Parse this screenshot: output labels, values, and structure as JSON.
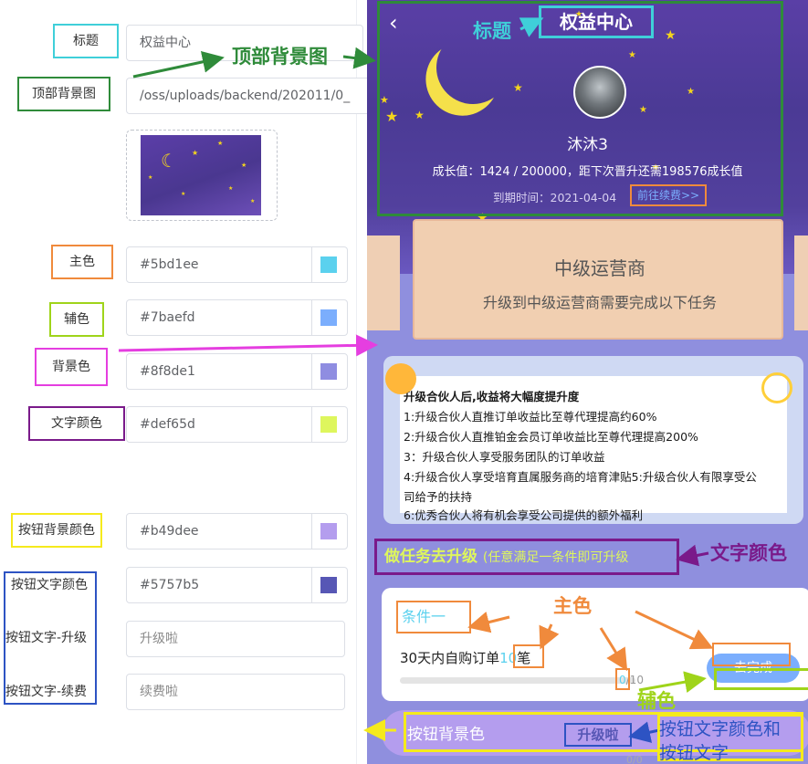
{
  "editor": {
    "fields": [
      {
        "label": "标题",
        "value": "权益中心",
        "placeholder": ""
      },
      {
        "label": "顶部背景图",
        "value": "/oss/uploads/backend/202011/0_",
        "placeholder": ""
      },
      {
        "label": "主色",
        "value": "#5bd1ee"
      },
      {
        "label": "辅色",
        "value": "#7baefd"
      },
      {
        "label": "背景色",
        "value": "#8f8de1"
      },
      {
        "label": "文字颜色",
        "value": "#def65d"
      },
      {
        "label": "按钮背景颜色",
        "value": "#b49dee"
      },
      {
        "label": "按钮文字颜色",
        "value": "#5757b5"
      },
      {
        "label": "按钮文字-升级",
        "placeholder": "升级啦"
      },
      {
        "label": "按钮文字-续费",
        "placeholder": "续费啦"
      }
    ],
    "swatches": [
      "#5bd1ee",
      "#7baefd",
      "#8f8de1",
      "#def65d",
      "#b49dee",
      "#5757b5"
    ],
    "label_border_colors": {
      "title": "#3fcfd9",
      "bg_image": "#2f8b3a",
      "primary": "#f08a3c",
      "secondary": "#9fd41a",
      "background": "#e53ee0",
      "text": "#7a1a8a",
      "btn_bg": "#f5ea1c",
      "btn_text": "#2d53c3"
    }
  },
  "annotations": {
    "bg_image": "顶部背景图",
    "title": "标题",
    "text_color": "文字颜色",
    "primary": "主色",
    "secondary": "辅色",
    "btn_bg": "按钮背景色",
    "btn_text_line1": "按钮文字颜色和",
    "btn_text_line2": "按钮文字"
  },
  "preview": {
    "back_icon": "chevron-left-icon",
    "title": "权益中心",
    "user_name": "沐沐3",
    "growth_text": "成长值：1424 / 200000，距下次晋升还需198576成长值",
    "expire_label": "到期时间：2021-04-04",
    "renew_link": "前往续费>>",
    "level_name": "中级运营商",
    "level_desc": "升级到中级运营商需要完成以下任务",
    "notice_lines": [
      "升级合伙人后,收益将大幅度提升度",
      "1:升级合伙人直推订单收益比至尊代理提高约60%",
      "2:升级合伙人直推铂金会员订单收益比至尊代理提高200%",
      "3：升级合伙人享受服务团队的订单收益",
      "4:升级合伙人享受培育直属服务商的培育津贴5:升级合伙人有限享受公",
      "司给予的扶持",
      "6:优秀合伙人将有机会享受公司提供的额外福利"
    ],
    "task_heading": "做任务去升级",
    "task_heading_sub": "(任意满足一条件即可升级",
    "condition_label": "条件一",
    "task_desc_prefix": "30天内自购订单",
    "task_desc_num": "10",
    "task_desc_suffix": "笔",
    "progress_current": "0",
    "progress_total": "/10",
    "progress_fraction": 0,
    "go_button": "去完成",
    "upgrade_label": "按钮背景色",
    "upgrade_button": "升级啦",
    "bottom_fragment": "0/0"
  }
}
